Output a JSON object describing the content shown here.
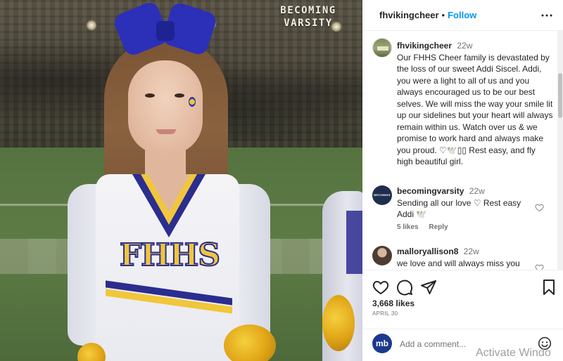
{
  "photo": {
    "watermark_line1": "BECOMING",
    "watermark_line2": "VARSITY",
    "uniform_letters": "FHHS"
  },
  "header": {
    "username": "fhvikingcheer",
    "separator": "•",
    "follow_label": "Follow",
    "more_icon": "more-horizontal-icon"
  },
  "caption": {
    "username": "fhvikingcheer",
    "time": "22w",
    "text": "Our FHHS Cheer family is devastated by the loss of our sweet Addi Siscel. Addi, you were a light to all of us and you always encouraged us to be our best selves. We will miss the way your smile lit up our sidelines but your heart will always remain within us. Watch over us & we promise to work hard and always make you proud. ♡🕊️▯▯ Rest easy, and fly high beautiful girl."
  },
  "comments": [
    {
      "username": "becomingvarsity",
      "time": "22w",
      "text": "Sending all our love ♡ Rest easy Addi 🕊️",
      "likes": "5 likes",
      "reply": "Reply",
      "avatar_text": "BECOMING VARSITY"
    },
    {
      "username": "malloryallison8",
      "time": "22w",
      "text": "we love and will always miss you"
    }
  ],
  "actions": {
    "icons": [
      "heart-icon",
      "comment-icon",
      "share-icon",
      "bookmark-icon"
    ],
    "likes": "3,668 likes",
    "date": "APRIL 30"
  },
  "composer": {
    "avatar_text": "mb",
    "placeholder": "Add a comment...",
    "emoji_icon": "emoji-icon"
  },
  "overlay": {
    "activate_text": "Activate Windo"
  },
  "colors": {
    "link": "#0095f6",
    "text": "#262626",
    "muted": "#737373",
    "bow": "#2c2fb8",
    "uniform_gold": "#f0c63b"
  }
}
